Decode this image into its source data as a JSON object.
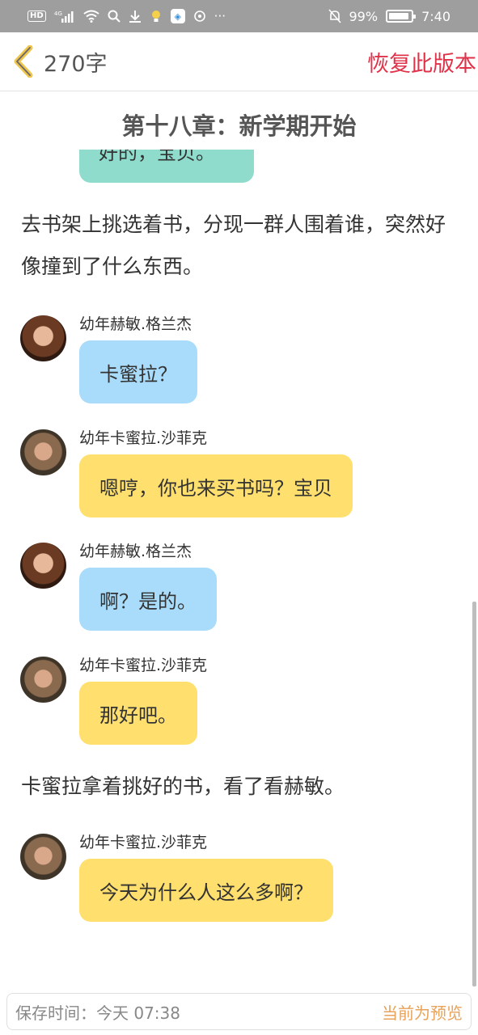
{
  "status_bar": {
    "hd": "HD",
    "network": "4G",
    "battery_percent": "99%",
    "time": "7:40"
  },
  "nav": {
    "word_count": "270字",
    "restore_label": "恢复此版本"
  },
  "chapter": {
    "title": "第十八章：新学期开始",
    "partial_bubble_text": "好的，宝贝。"
  },
  "narration": [
    "去书架上挑选着书，分现一群人围着谁，突然好像撞到了什么东西。",
    "卡蜜拉拿着挑好的书，看了看赫敏。"
  ],
  "messages": [
    {
      "speaker": "幼年赫敏.格兰杰",
      "text": "卡蜜拉？",
      "color": "#a9dcfa",
      "avatar": "hermione-avatar"
    },
    {
      "speaker": "幼年卡蜜拉.沙菲克",
      "text": "嗯哼，你也来买书吗？宝贝",
      "color": "#ffdf6e",
      "avatar": "camilla-avatar"
    },
    {
      "speaker": "幼年赫敏.格兰杰",
      "text": "啊？是的。",
      "color": "#a9dcfa",
      "avatar": "hermione-avatar"
    },
    {
      "speaker": "幼年卡蜜拉.沙菲克",
      "text": "那好吧。",
      "color": "#ffdf6e",
      "avatar": "camilla-avatar"
    },
    {
      "speaker": "幼年卡蜜拉.沙菲克",
      "text": "今天为什么人这么多啊？",
      "color": "#ffdf6e",
      "avatar": "camilla-avatar"
    }
  ],
  "footer": {
    "save_time": "保存时间：今天 07:38",
    "preview_label": "当前为预览"
  },
  "colors": {
    "accent_red": "#e0334a",
    "status_bar_bg": "#9e9e9e",
    "preview_orange": "#e8a25a"
  }
}
